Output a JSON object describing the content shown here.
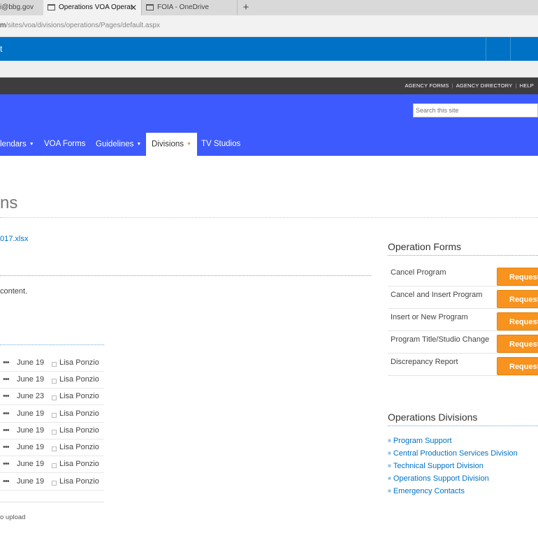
{
  "browser": {
    "tabs": [
      {
        "label": "i@bbg.gov"
      },
      {
        "label": "Operations VOA Operat"
      },
      {
        "label": "FOIA - OneDrive"
      }
    ],
    "address": {
      "host_tail": "m",
      "path": "/sites/voa/divisions/operations/Pages/default.aspx"
    }
  },
  "suitebar": {
    "mark": "t"
  },
  "agency": {
    "links": [
      "AGENCY FORMS",
      "AGENCY DIRECTORY",
      "HELP"
    ]
  },
  "header": {
    "search_placeholder": "Search this site",
    "nav": [
      {
        "label": "lendars",
        "dropdown": true
      },
      {
        "label": "VOA Forms",
        "dropdown": false
      },
      {
        "label": "Guidelines",
        "dropdown": true
      },
      {
        "label": "Divisions",
        "dropdown": true,
        "active": true
      },
      {
        "label": "TV Studios",
        "dropdown": false
      }
    ]
  },
  "page": {
    "title": "ns",
    "file_link": "017.xlsx",
    "content_text": "content.",
    "upload_text": "o upload"
  },
  "documents": {
    "rows": [
      {
        "date": "June 19",
        "author": "Lisa Ponzio"
      },
      {
        "date": "June 19",
        "author": "Lisa Ponzio"
      },
      {
        "date": "June 23",
        "author": "Lisa Ponzio"
      },
      {
        "date": "June 19",
        "author": "Lisa Ponzio"
      },
      {
        "date": "June 19",
        "author": "Lisa Ponzio"
      },
      {
        "date": "June 19",
        "author": "Lisa Ponzio"
      },
      {
        "date": "June 19",
        "author": "Lisa Ponzio"
      },
      {
        "date": "June 19",
        "author": "Lisa Ponzio"
      }
    ]
  },
  "operation_forms": {
    "title": "Operation Forms",
    "button_label": "Request",
    "items": [
      {
        "label": "Cancel Program"
      },
      {
        "label": "Cancel and Insert Program"
      },
      {
        "label": "Insert or New Program"
      },
      {
        "label": "Program Title/Studio Change"
      },
      {
        "label": "Discrepancy Report"
      }
    ]
  },
  "operations_divisions": {
    "title": "Operations Divisions",
    "links": [
      {
        "label": "Program Support"
      },
      {
        "label": "Central Production Services Division"
      },
      {
        "label": "Technical Support Division"
      },
      {
        "label": "Operations Support Division"
      },
      {
        "label": "Emergency Contacts"
      }
    ]
  },
  "colors": {
    "suitebar": "#0072c6",
    "header": "#3d5afe",
    "agency_bar": "#3d3d3d",
    "request_button": "#f7931e",
    "link": "#0072c6"
  }
}
